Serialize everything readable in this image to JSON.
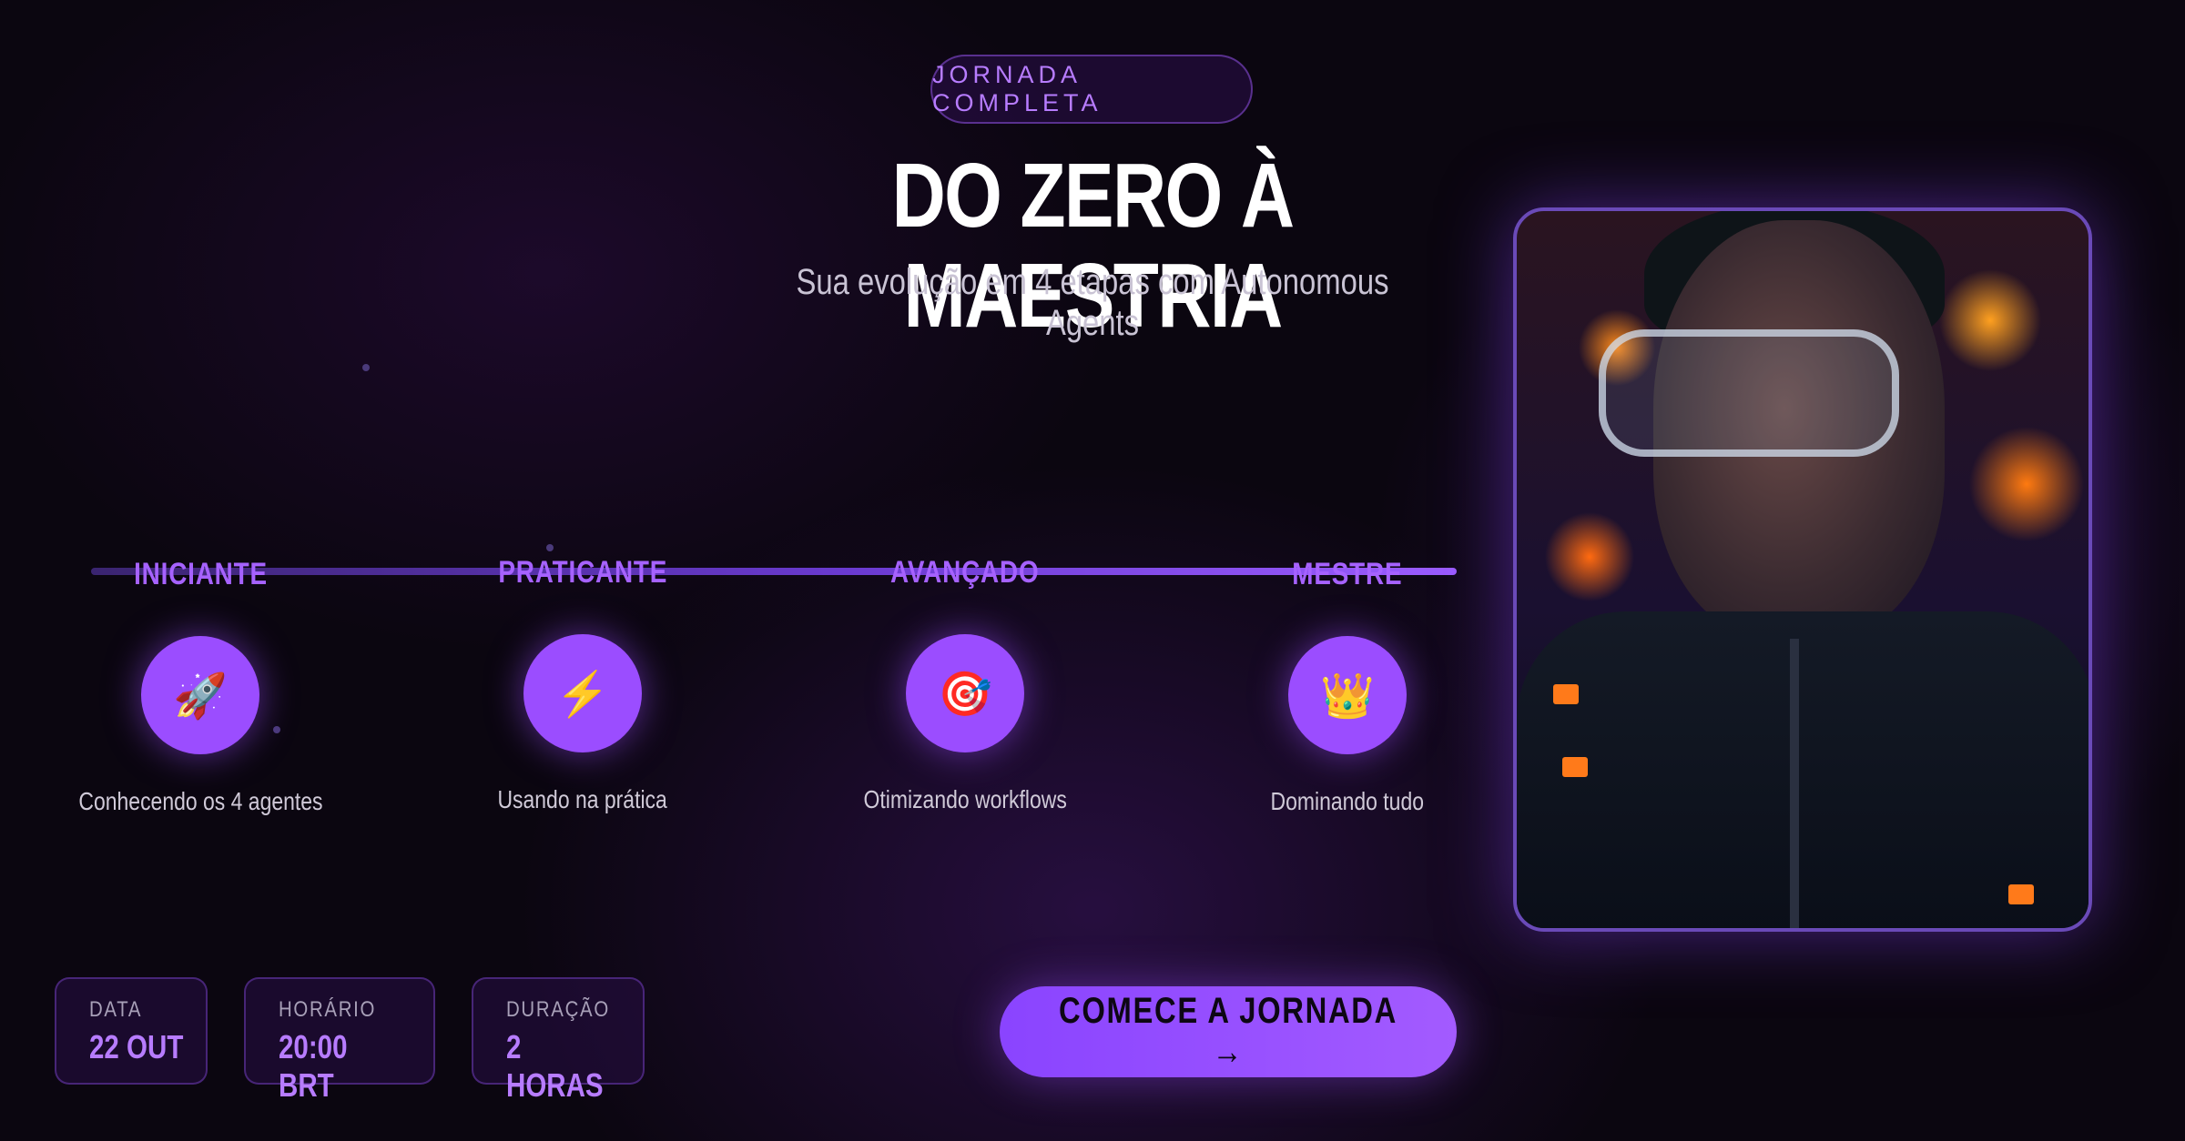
{
  "badge": "JORNADA COMPLETA",
  "title": "DO ZERO À MAESTRIA",
  "subtitle": "Sua evolução em 4 etapas com Autonomous Agents",
  "stages": [
    {
      "label": "INICIANTE",
      "icon": "🚀",
      "icon_name": "rocket-icon",
      "description": "Conhecendo os 4 agentes"
    },
    {
      "label": "PRATICANTE",
      "icon": "⚡",
      "icon_name": "lightning-icon",
      "description": "Usando na prática"
    },
    {
      "label": "AVANÇADO",
      "icon": "🎯",
      "icon_name": "target-icon",
      "description": "Otimizando workflows"
    },
    {
      "label": "MESTRE",
      "icon": "👑",
      "icon_name": "crown-icon",
      "description": "Dominando tudo"
    }
  ],
  "info": {
    "date_label": "DATA",
    "date_value": "22 OUT",
    "time_label": "HORÁRIO",
    "time_value": "20:00 BRT",
    "duration_label": "DURAÇÃO",
    "duration_value": "2 HORAS"
  },
  "cta": "COMECE A JORNADA →",
  "colors": {
    "accent": "#9b4dff",
    "accent_text": "#a662ff",
    "background": "#0b0610"
  }
}
